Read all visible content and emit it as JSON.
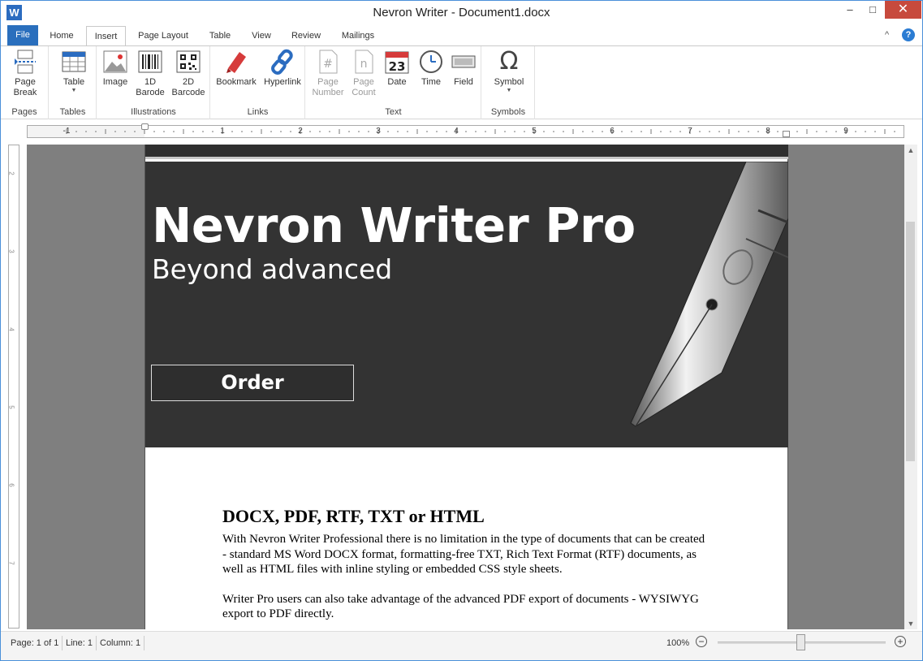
{
  "window": {
    "app_icon": "W",
    "title": "Nevron Writer - Document1.docx",
    "min": "–",
    "max": "□",
    "close": "✕"
  },
  "tabs": {
    "file": "File",
    "home": "Home",
    "insert": "Insert",
    "page_layout": "Page Layout",
    "table": "Table",
    "view": "View",
    "review": "Review",
    "mailings": "Mailings",
    "collapse": "^",
    "help": "?"
  },
  "ribbon": {
    "pages": {
      "label": "Pages",
      "page_break": "Page\nBreak"
    },
    "tables": {
      "label": "Tables",
      "table": "Table"
    },
    "illustrations": {
      "label": "Illustrations",
      "image": "Image",
      "barcode1d": "1D\nBarode",
      "barcode2d": "2D\nBarcode"
    },
    "links": {
      "label": "Links",
      "bookmark": "Bookmark",
      "hyperlink": "Hyperlink"
    },
    "text": {
      "label": "Text",
      "page_number": "Page\nNumber",
      "page_count": "Page\nCount",
      "date": "Date",
      "date_day": "23",
      "time": "Time",
      "field": "Field"
    },
    "symbols": {
      "label": "Symbols",
      "symbol": "Symbol",
      "symbol_glyph": "Ω"
    }
  },
  "ruler": {
    "labels": [
      "-1",
      "1",
      "2",
      "3",
      "4",
      "5",
      "6",
      "7",
      "8",
      "9"
    ],
    "vlabels": [
      "2",
      "3",
      "4",
      "5",
      "6",
      "7"
    ]
  },
  "document": {
    "banner_title": "Nevron Writer Pro",
    "banner_subtitle": "Beyond advanced",
    "order_button": "Order",
    "heading": "DOCX, PDF, RTF, TXT or HTML",
    "para1": "With Nevron Writer Professional there is no limitation in the type of documents that can be created - standard MS Word DOCX format, formatting-free TXT, Rich Text Format (RTF) documents, as well as HTML files with inline styling or embedded CSS style sheets.",
    "para2": "Writer Pro users can also take advantage of the advanced PDF export of documents - WYSIWYG export to PDF directly."
  },
  "status": {
    "page": "Page: 1 of 1",
    "line": "Line: 1",
    "column": "Column: 1",
    "zoom": "100%",
    "zoom_out": "−",
    "zoom_in": "+"
  },
  "colors": {
    "accent": "#2a6fbd",
    "close": "#c74a3d",
    "banner": "#333333",
    "workspace": "#7f7f7f"
  }
}
